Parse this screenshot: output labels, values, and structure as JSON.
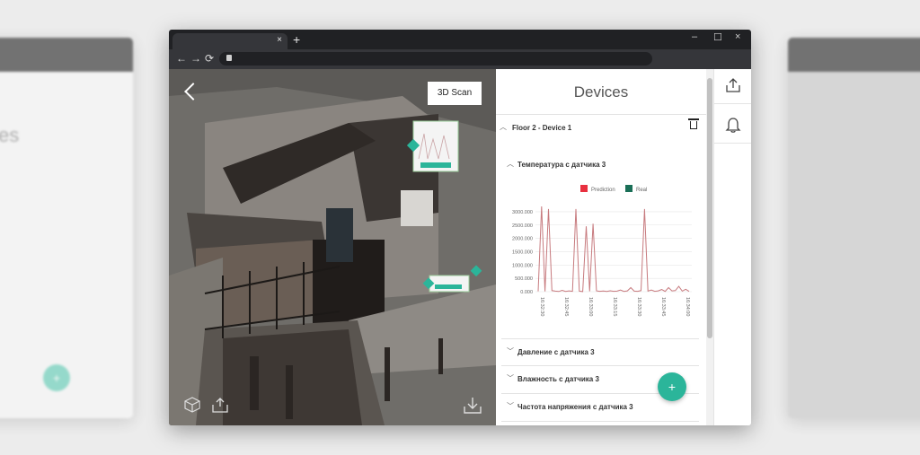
{
  "browser": {
    "tab_close": "×",
    "new_tab": "+",
    "window_controls": [
      "–",
      "☐",
      "×"
    ],
    "nav": [
      "←",
      "→",
      "⟳"
    ]
  },
  "viewer": {
    "label": "3D Scan",
    "icons": [
      "back-arrow-icon",
      "cube-icon",
      "share-icon",
      "download-icon"
    ]
  },
  "devices": {
    "title": "Devices",
    "device": "Floor 2 - Device 1",
    "sensor_open": "Температура с датчика 3",
    "sensors": [
      "Давление с датчика 3",
      "Влажность с датчика 3",
      "Частота напряжения с датчика 3"
    ],
    "fab": "+"
  },
  "sidebar_icons": [
    "upload-icon",
    "bell-icon"
  ],
  "colors": {
    "prediction": "#e8303f",
    "real": "#1a6f57",
    "accent": "#2bb59a",
    "chart_line": "#c77a7e"
  },
  "chart_data": {
    "type": "line",
    "legend": [
      "Prediction",
      "Real"
    ],
    "x_ticks": [
      "16:32:30",
      "16:32:45",
      "16:33:00",
      "16:33:15",
      "16:33:30",
      "16:33:45",
      "16:34:00"
    ],
    "y_ticks": [
      "0.000",
      "500.000",
      "1000.000",
      "1500.000",
      "2000.000",
      "2500.000",
      "3000.000"
    ],
    "ylim": [
      0,
      3300000
    ],
    "series": [
      {
        "name": "Real",
        "values": [
          15000,
          3200000,
          10000,
          3100000,
          40000,
          20000,
          8000,
          50000,
          10000,
          30000,
          15000,
          3100000,
          20000,
          5000,
          2450000,
          12000,
          2550000,
          30000,
          12000,
          25000,
          10000,
          35000,
          12000,
          20000,
          60000,
          10000,
          30000,
          150000,
          20000,
          12000,
          40000,
          3100000,
          25000,
          60000,
          12000,
          30000,
          80000,
          10000,
          150000,
          30000,
          40000,
          200000,
          20000,
          90000,
          10000
        ]
      }
    ]
  }
}
